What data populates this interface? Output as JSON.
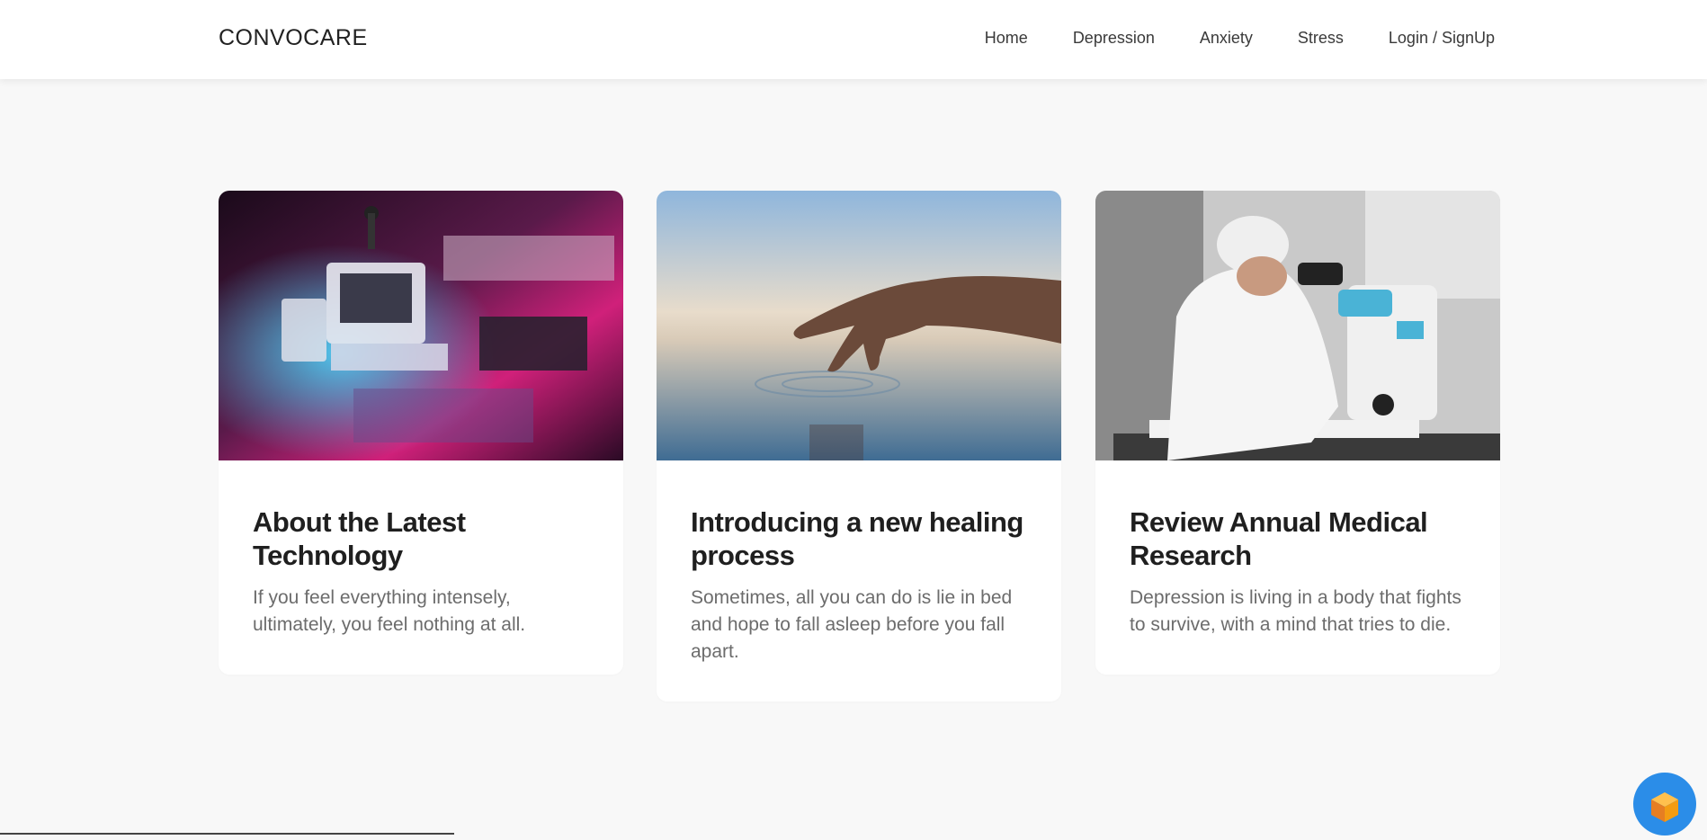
{
  "navbar": {
    "brand": "CONVOCARE",
    "links": [
      "Home",
      "Depression",
      "Anxiety",
      "Stress",
      "Login / SignUp"
    ]
  },
  "cards": [
    {
      "image_icon": "retro-computers-image",
      "title": "About the Latest Technology",
      "text": "If you feel everything intensely, ultimately, you feel nothing at all."
    },
    {
      "image_icon": "hand-over-water-image",
      "title": "Introducing a new healing process",
      "text": "Sometimes, all you can do is lie in bed and hope to fall asleep before you fall apart."
    },
    {
      "image_icon": "scientist-microscope-image",
      "title": "Review Annual Medical Research",
      "text": "Depression is living in a body that fights to survive, with a mind that tries to die."
    }
  ],
  "colors": {
    "background": "#f8f8f8",
    "card": "#ffffff",
    "fab": "#2b8de8",
    "fab_icon": "#f39c12"
  },
  "fab_icon": "cube-icon"
}
